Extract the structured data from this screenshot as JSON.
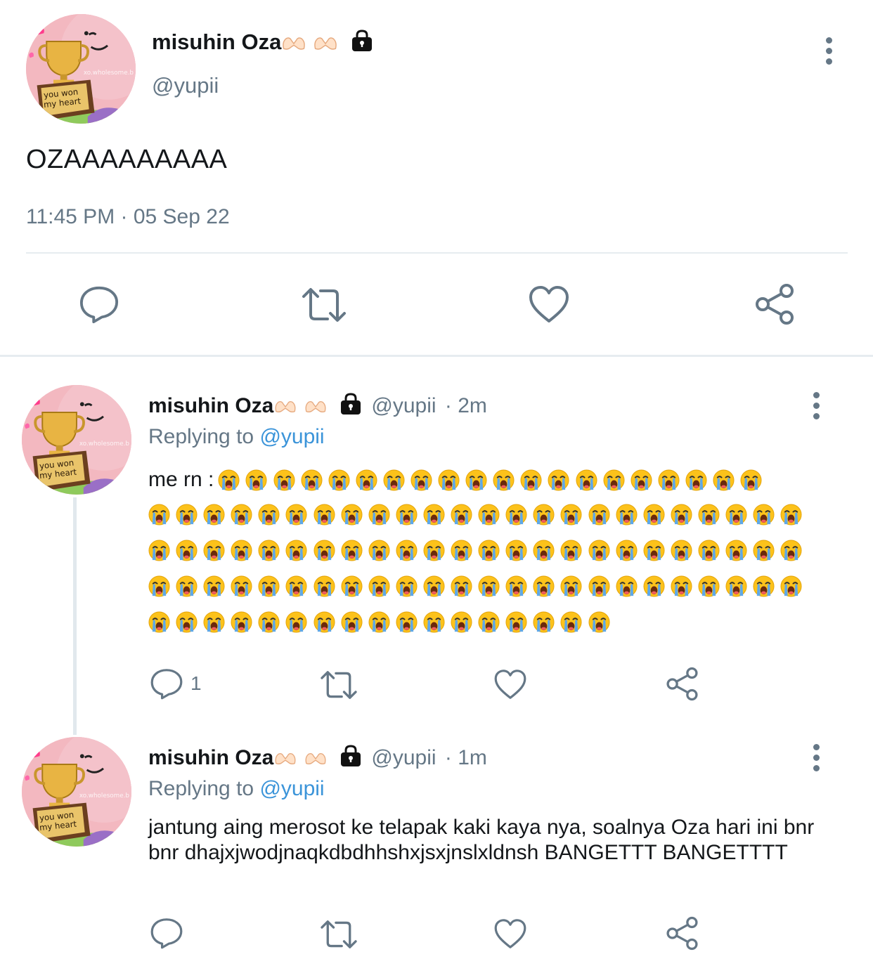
{
  "main_tweet": {
    "display_name": "misuhin Oza",
    "name_emoji": "🫶🏻 🫶🏻",
    "handle": "@yupii",
    "text": "OZAAAAAAAAA",
    "timestamp": "11:45 PM · 05 Sep 22",
    "avatar_text": "you won my heart",
    "avatar_watermark": "xo.wholesome.b"
  },
  "replies": [
    {
      "display_name": "misuhin Oza",
      "handle": "@yupii",
      "time": "· 2m",
      "replying_label": "Replying to",
      "replying_to": "@yupii",
      "text_lead": "me rn :",
      "emoji": "😭",
      "emoji_rows": [
        20,
        24,
        24,
        24,
        17
      ],
      "reply_count": "1"
    },
    {
      "display_name": "misuhin Oza",
      "handle": "@yupii",
      "time": "· 1m",
      "replying_label": "Replying to",
      "replying_to": "@yupii",
      "text": "jantung aing merosot ke telapak kaki kaya nya, soalnya Oza hari ini bnr bnr dhajxjwodjnaqkdbdhhshxjsxjnslxldnsh BANGETTT BANGETTTT"
    }
  ],
  "colors": {
    "text": "#14171a",
    "secondary": "#657786",
    "link": "#3b94d9",
    "divider": "#e6ecf0"
  },
  "icons": [
    "reply-icon",
    "retweet-icon",
    "like-icon",
    "share-icon",
    "lock-icon",
    "more-icon",
    "heart-hands-icon",
    "loudly-crying-face-icon"
  ]
}
